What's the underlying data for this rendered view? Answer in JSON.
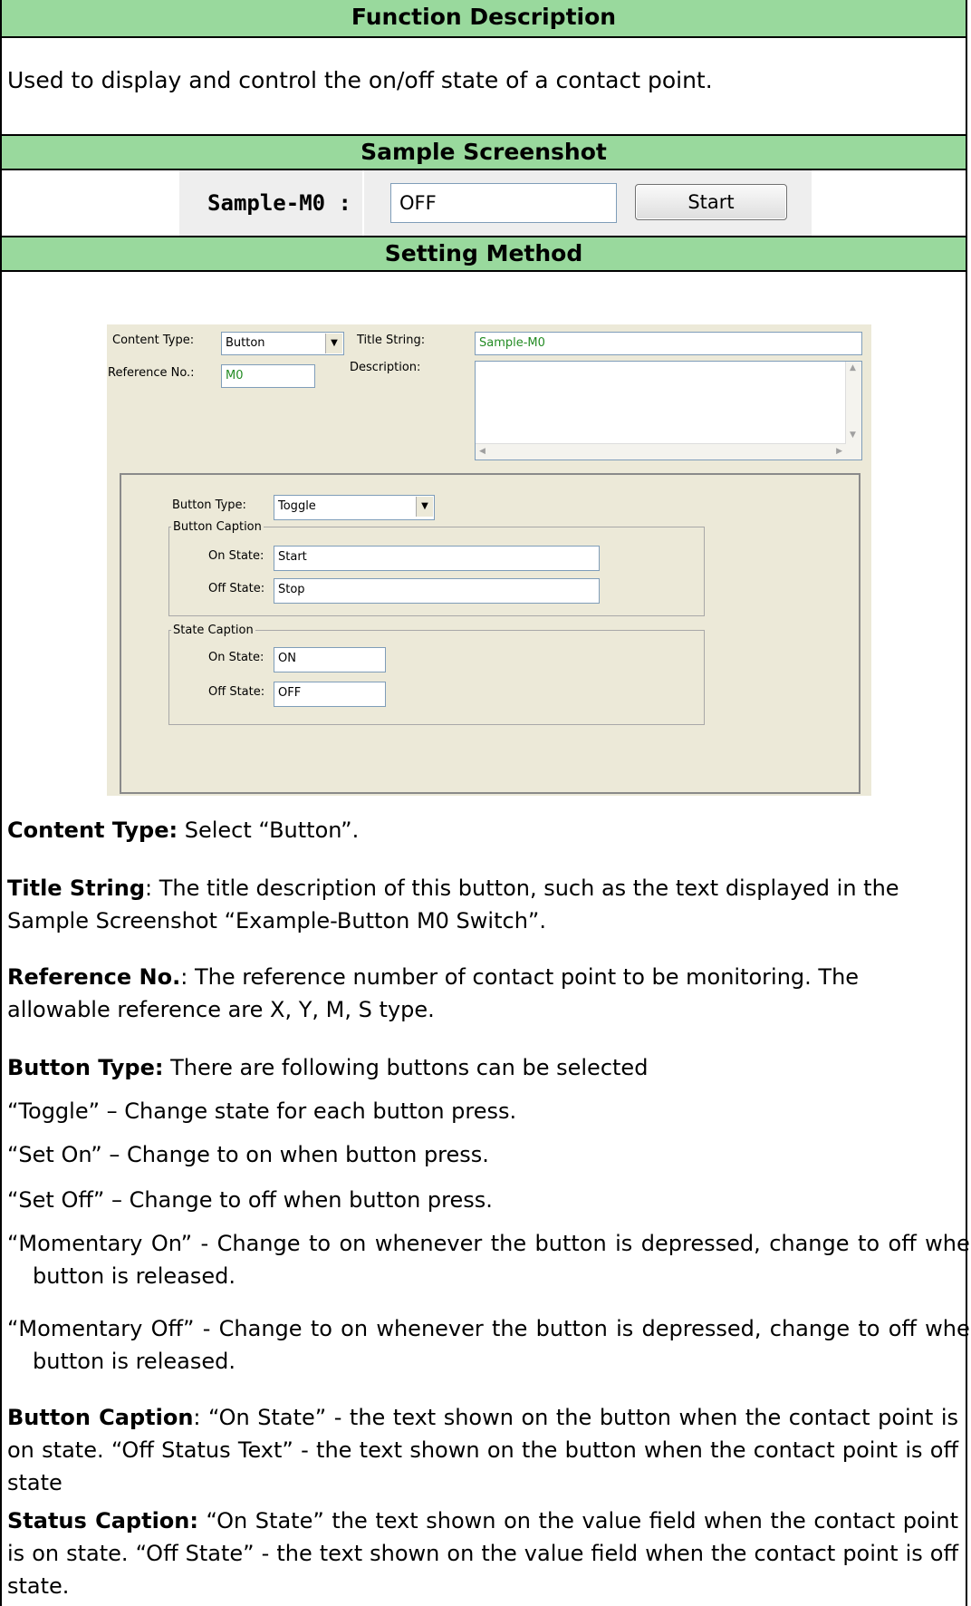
{
  "sections": {
    "function_description": "Function Description",
    "sample_screenshot": "Sample Screenshot",
    "setting_method": "Setting Method"
  },
  "function_text": "Used to display and control the on/off state of a contact point.",
  "sample": {
    "label": "Sample-M0 :",
    "value": "OFF",
    "button": "Start"
  },
  "dialog": {
    "content_type_label": "Content Type:",
    "content_type_value": "Button",
    "title_string_label": "Title String:",
    "title_string_value": "Sample-M0",
    "reference_label": "Reference No.:",
    "reference_value": "M0",
    "description_label": "Description:",
    "button_type_label": "Button Type:",
    "button_type_value": "Toggle",
    "button_caption_legend": "Button Caption",
    "state_caption_legend": "State Caption",
    "on_state_label": "On State:",
    "off_state_label": "Off State:",
    "button_on_value": "Start",
    "button_off_value": "Stop",
    "state_on_value": "ON",
    "state_off_value": "OFF"
  },
  "paragraphs": {
    "content_type_term": "Content Type:",
    "content_type_text": " Select “Button”.",
    "title_string_term": "Title String",
    "title_string_text": ": The title description of this button, such as the text displayed in the Sample Screenshot “Example-Button M0 Switch”.",
    "reference_term": "Reference No.",
    "reference_text": ": The reference number of contact point to be monitoring. The allowable reference are X, Y, M, S type.",
    "button_type_term": "Button Type:",
    "button_type_text": " There are following buttons can be selected",
    "toggle": "“Toggle” – Change state for each button press.",
    "set_on": "“Set On” – Change to on when button press.",
    "set_off": "“Set Off” – Change to off when button press.",
    "momentary_on": "“Momentary On” - Change to on whenever the button is depressed, change to off when button is released.",
    "momentary_off": "“Momentary Off” - Change to on whenever the button is depressed, change to off when button is released.",
    "button_caption_term": "Button Caption",
    "button_caption_text": ": “On State” - the text shown on the button when the contact point is on state. “Off Status Text” - the text shown on the button when the contact point is off state",
    "status_caption_term": "Status Caption:",
    "status_caption_text": " “On State” the text shown on the value field when the contact point is on state. “Off State” - the text shown on the value field when the contact point is off state."
  },
  "colors": {
    "header_band": "#99d99d",
    "dialog_bg": "#ece9d8",
    "field_text_green": "#238b23"
  }
}
